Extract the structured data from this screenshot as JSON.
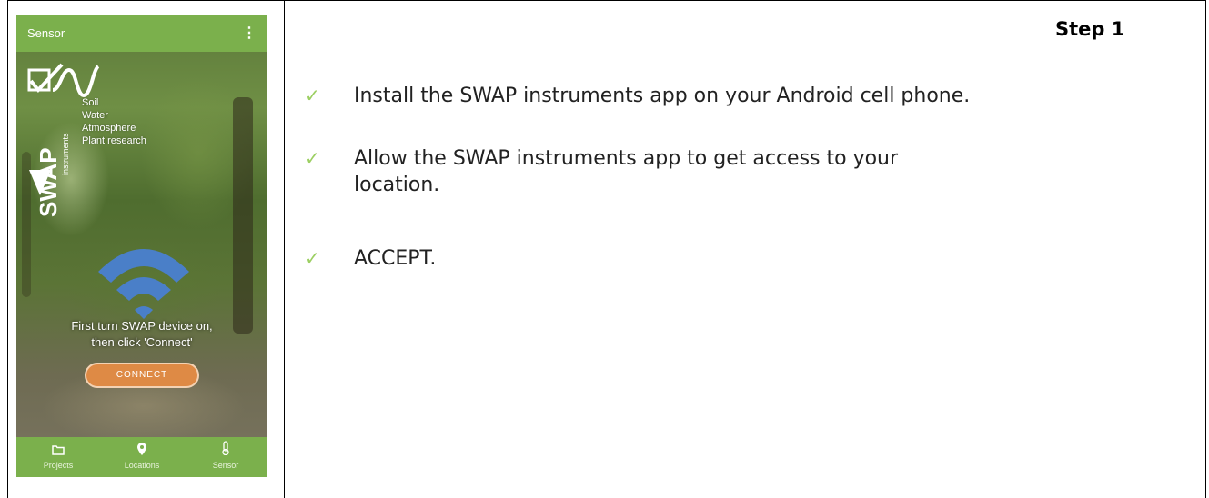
{
  "phone": {
    "appbar_title": "Sensor",
    "appbar_menu": "⋮",
    "logo_brand": "SWAP",
    "logo_instruments": "instruments",
    "logo_lines": [
      "Soil",
      "Water",
      "Atmosphere",
      "Plant research"
    ],
    "message_line1": "First turn SWAP device on,",
    "message_line2": "then click 'Connect'",
    "connect_label": "CONNECT",
    "nav": [
      {
        "label": "Projects",
        "icon": "folder-icon"
      },
      {
        "label": "Locations",
        "icon": "location-pin-icon"
      },
      {
        "label": "Sensor",
        "icon": "thermometer-icon"
      }
    ],
    "colors": {
      "bar": "#7bb04c",
      "connect": "#de8a45",
      "wifi": "#4a7fc8"
    }
  },
  "content": {
    "step_title": "Step 1",
    "check_mark": "✓",
    "items": [
      {
        "lines": [
          "Install the SWAP instruments app on your Android cell phone."
        ]
      },
      {
        "lines": [
          "Allow the SWAP instruments app to get access to your",
          "location."
        ]
      },
      {
        "lines": [
          "ACCEPT."
        ]
      }
    ],
    "check_color": "#9ccf62"
  }
}
